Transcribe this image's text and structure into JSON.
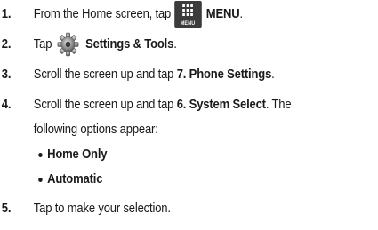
{
  "steps": {
    "s1": {
      "num": "1.",
      "text": "From the Home screen, tap",
      "bold": "MENU",
      "icon_caption": "MENU",
      "tail": "."
    },
    "s2": {
      "num": "2.",
      "text": "Tap",
      "bold": "Settings & Tools",
      "tail": "."
    },
    "s3": {
      "num": "3.",
      "text": "Scroll the screen up and tap ",
      "bold": "7. Phone Settings",
      "tail": "."
    },
    "s4": {
      "num": "4.",
      "text": "Scroll the screen up and tap ",
      "bold": "6. System Select",
      "tail": ". The",
      "text2": "following options appear:"
    },
    "bullets": [
      "Home Only",
      "Automatic"
    ],
    "s5": {
      "num": "5.",
      "text": "Tap to make your selection."
    }
  },
  "icons": {
    "menu": "menu-grid-icon",
    "settings": "settings-gear-icon"
  },
  "colors": {
    "text": "#1a1a1a",
    "menu_icon_bg": "#3b3b3b"
  }
}
